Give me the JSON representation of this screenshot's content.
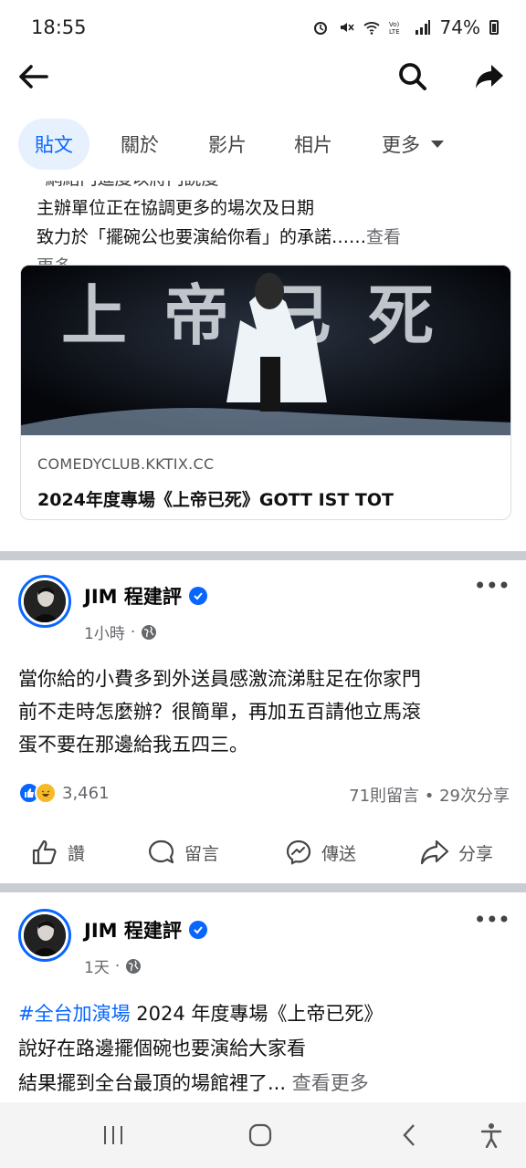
{
  "status_bar": {
    "time": "18:55",
    "battery": "74%",
    "icons": [
      "alarm-icon",
      "mute-icon",
      "wifi-icon",
      "volte-icon",
      "signal-icon",
      "battery-icon"
    ]
  },
  "top_bar": {
    "icons": [
      "back-arrow-icon",
      "search-icon",
      "share-icon"
    ]
  },
  "tabs": [
    {
      "label": "貼文",
      "active": true
    },
    {
      "label": "關於"
    },
    {
      "label": "影片"
    },
    {
      "label": "相片"
    },
    {
      "label": "更多"
    }
  ],
  "post_partial": {
    "text_top": "*網絡門進度以將門說度",
    "line1": "主辦單位正在協調更多的場次及日期",
    "line2": "致力於「擺碗公也要演給你看」的承諾……",
    "see_more": "查看",
    "see_more_2": "更多",
    "link_card": {
      "domain": "COMEDYCLUB.KKTIX.CC",
      "title": "2024年度專場《上帝已死》GOTT IST TOT",
      "image_title": "上帝已死"
    }
  },
  "post2": {
    "author": "JIM 程建評",
    "time": "1小時",
    "lines": [
      "當你給的小費多到外送員感激流涕駐足在你家門",
      "前不走時怎麼辦？很簡單，再加五百請他立馬滾",
      "蛋不要在那邊給我五四三。"
    ],
    "reaction_count": "3,461",
    "comments_shares": "71則留言 • 29次分享",
    "actions": [
      {
        "label": "讚",
        "icon": "like-icon"
      },
      {
        "label": "留言",
        "icon": "comment-icon"
      },
      {
        "label": "傳送",
        "icon": "messenger-icon"
      },
      {
        "label": "分享",
        "icon": "share-icon"
      }
    ]
  },
  "post3": {
    "author": "JIM 程建評",
    "time": "1天",
    "hashtag": "#全台加演場",
    "line1_rest": " 2024 年度專場《上帝已死》",
    "line2": "說好在路邊擺個碗也要演給大家看",
    "line3": "結果擺到全台最頂的場館裡了... ",
    "see_more": "查看更多"
  },
  "colors": {
    "accent": "#0866ff",
    "secondary_text": "#65676b",
    "divider": "#c9ccd1",
    "haha": "#f7b928"
  }
}
